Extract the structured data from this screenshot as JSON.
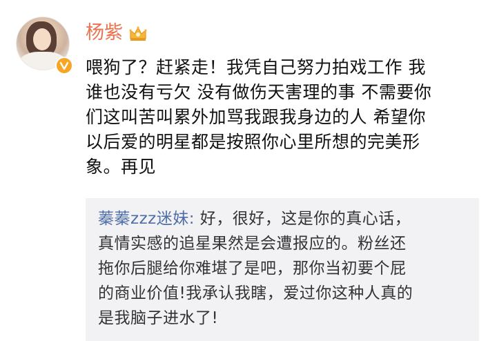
{
  "post": {
    "username": "杨紫",
    "content_lines": [
      "喂狗了？赶紧走！我凭自己努力拍戏工作 我",
      "谁也没有亏欠 没有做伤天害理的事 不需要你",
      "们这叫苦叫累外加骂我跟我身边的人 希望你",
      "以后爱的明星都是按照你心里所想的完美形",
      "象。再见"
    ]
  },
  "repost": {
    "author": "蓁蓁zzz迷妹:",
    "lines": [
      " 好，很好，这是你的真心话，",
      "真情实感的追星果然是会遭报应的。粉丝还",
      "拖你后腿给你难堪了是吧，那你当初要个屁",
      "的商业价值!我承认我瞎，爱过你这种人真的",
      "是我脑子进水了!"
    ]
  },
  "icons": {
    "avatar": "avatar",
    "verified": "verified-badge-icon",
    "vip": "vip-crown-icon"
  },
  "colors": {
    "username": "#eb7350",
    "repost_author": "#4e6ea6",
    "repost_bg": "#f2f2f5",
    "verified_badge": "#f6a623"
  }
}
